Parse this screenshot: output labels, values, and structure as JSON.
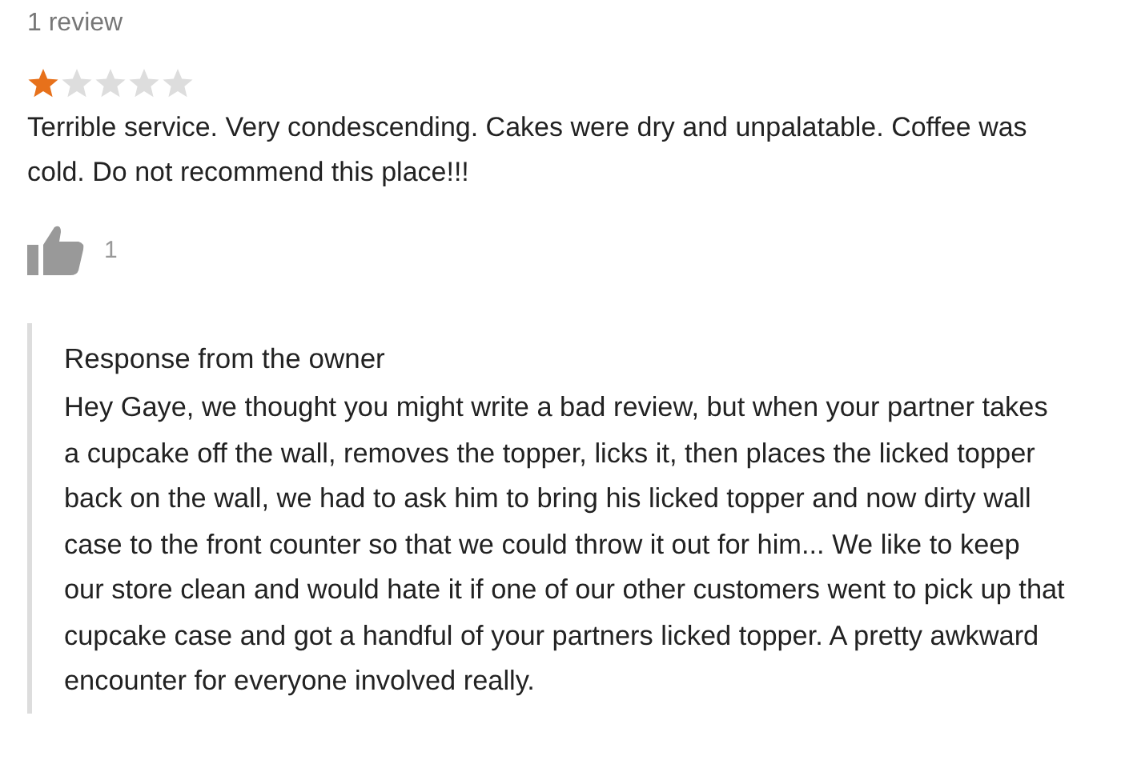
{
  "review": {
    "count_label": "1 review",
    "stars": 1,
    "text": "Terrible service. Very condescending. Cakes were dry and unpalatable. Coffee was cold. Do not recommend this place!!!",
    "likes": "1"
  },
  "owner_response": {
    "title": "Response from the owner",
    "text": "Hey Gaye, we thought you might write a bad review, but when your partner takes a cupcake off the wall, removes the topper, licks it, then places the licked topper back on the wall, we had to ask him to bring his licked topper and now dirty wall case to the front counter so that we could throw it out for him... We like to keep our store clean and would hate it if one of our other customers went to pick up that cupcake case and got a handful of your partners licked topper. A pretty awkward encounter for everyone involved really."
  }
}
